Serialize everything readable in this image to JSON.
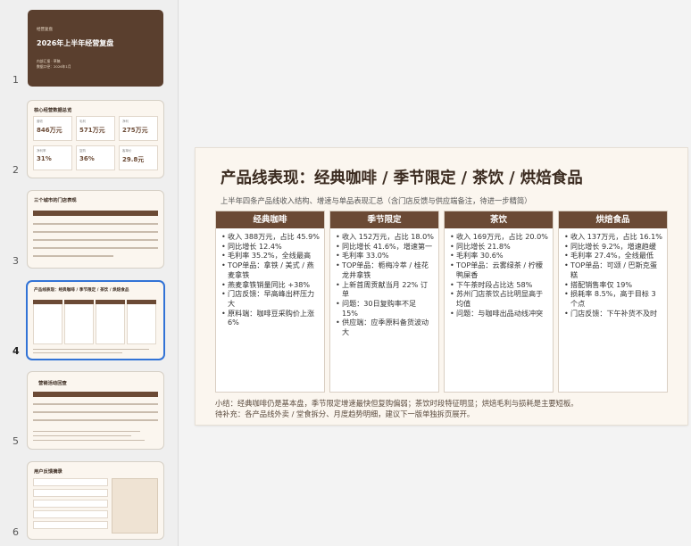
{
  "thumbnails": [
    {
      "num": "1",
      "kicker": "经营复盘",
      "title": "2026年上半年经营复盘",
      "meta1": "内部汇报 · 草稿",
      "meta2": "数据口径：2026年1月"
    },
    {
      "num": "2",
      "title": "核心经营数据总览",
      "cards": [
        {
          "label": "营收",
          "value": "846万元"
        },
        {
          "label": "毛利",
          "value": "571万元"
        },
        {
          "label": "净利",
          "value": "275万元"
        },
        {
          "label": "净利率",
          "value": "31%"
        },
        {
          "label": "复购",
          "value": "36%"
        },
        {
          "label": "客单价",
          "value": "29.8元"
        }
      ]
    },
    {
      "num": "3",
      "title": "三个城市的门店表现"
    },
    {
      "num": "4",
      "title": "产品线表现：经典咖啡 / 季节限定 / 茶饮 / 烘焙食品"
    },
    {
      "num": "5",
      "title": "营销活动回查"
    },
    {
      "num": "6",
      "title": "用户反馈摘录"
    }
  ],
  "slide": {
    "title": "产品线表现：经典咖啡 / 季节限定 / 茶饮 / 烘焙食品",
    "subtitle": "上半年四条产品线收入结构、增速与单品表现汇总（含门店反馈与供应端备注，待进一步精简）",
    "columns": [
      {
        "head": "经典咖啡",
        "items": [
          "收入 388万元，占比 45.9%",
          "同比增长 12.4%",
          "毛利率 35.2%，全线最高",
          "TOP单品：拿铁 / 美式 / 燕麦拿铁",
          "燕麦拿铁销量同比 +38%",
          "门店反馈：早高峰出杯压力大",
          "原料端：咖啡豆采购价上涨 6%"
        ]
      },
      {
        "head": "季节限定",
        "items": [
          "收入 152万元，占比 18.0%",
          "同比增长 41.6%，增速第一",
          "毛利率 33.0%",
          "TOP单品：栀梅冷萃 / 桂花龙井拿铁",
          "上新首周贡献当月 22% 订单",
          "问题：30日复购率不足 15%",
          "供应端：应季原料备货波动大"
        ]
      },
      {
        "head": "茶饮",
        "items": [
          "收入 169万元，占比 20.0%",
          "同比增长 21.8%",
          "毛利率 30.6%",
          "TOP单品：云雾绿茶 / 柠檬鸭屎香",
          "下午茶时段占比达 58%",
          "苏州门店茶饮占比明显高于均值",
          "问题：与咖啡出品动线冲突"
        ]
      },
      {
        "head": "烘焙食品",
        "items": [
          "收入 137万元，占比 16.1%",
          "同比增长 9.2%，增速趋缓",
          "毛利率 27.4%，全线最低",
          "TOP单品：可颂 / 巴斯克蛋糕",
          "搭配销售率仅 19%",
          "损耗率 8.5%，高于目标 3 个点",
          "门店反馈：下午补货不及时"
        ]
      }
    ],
    "summary1": "小结：经典咖啡仍是基本盘，季节限定增速最快但复购偏弱；茶饮时段特征明显；烘焙毛利与损耗是主要短板。",
    "summary2": "待补充：各产品线外卖 / 堂食拆分、月度趋势明细，建议下一版单独拆页展开。"
  }
}
